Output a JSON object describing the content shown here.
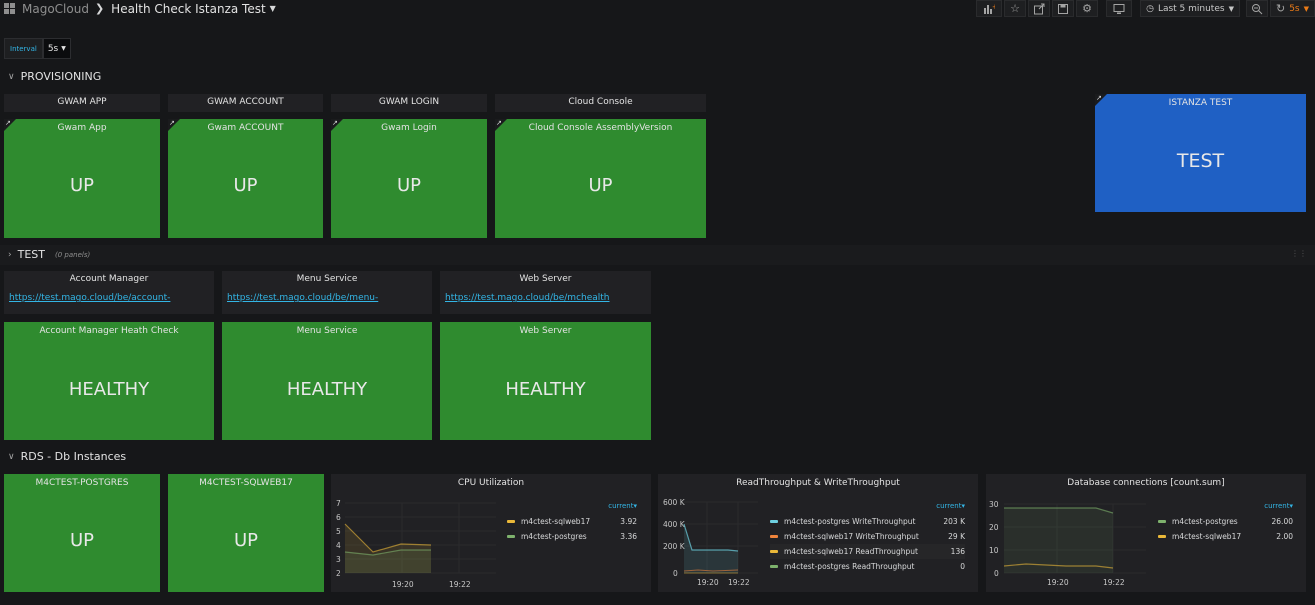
{
  "breadcrumb": {
    "root": "MagoCloud",
    "dashboard": "Health Check Istanza Test"
  },
  "toolbar": {
    "time_range": "Last 5 minutes",
    "refresh": "5s"
  },
  "variable": {
    "label": "Interval",
    "value": "5s"
  },
  "rows": {
    "provisioning": {
      "title": "PROVISIONING"
    },
    "test": {
      "title": "TEST",
      "subtitle": "(0 panels)"
    },
    "rds": {
      "title": "RDS - Db Instances"
    }
  },
  "provisioning": {
    "headers": [
      "GWAM APP",
      "GWAM ACCOUNT",
      "GWAM LOGIN",
      "Cloud Console"
    ],
    "stats": [
      {
        "title": "Gwam App",
        "value": "UP"
      },
      {
        "title": "Gwam ACCOUNT",
        "value": "UP"
      },
      {
        "title": "Gwam Login",
        "value": "UP"
      },
      {
        "title": "Cloud Console AssemblyVersion",
        "value": "UP"
      }
    ],
    "istanza": {
      "title": "ISTANZA TEST",
      "value": "TEST"
    }
  },
  "test": {
    "links": [
      {
        "title": "Account Manager",
        "url": "https://test.mago.cloud/be/account-"
      },
      {
        "title": "Menu Service",
        "url": "https://test.mago.cloud/be/menu-"
      },
      {
        "title": "Web Server",
        "url": "https://test.mago.cloud/be/mchealth"
      }
    ],
    "stats": [
      {
        "title": "Account Manager Heath Check",
        "value": "HEALTHY"
      },
      {
        "title": "Menu Service",
        "value": "HEALTHY"
      },
      {
        "title": "Web Server",
        "value": "HEALTHY"
      }
    ]
  },
  "rds": {
    "stats": [
      {
        "title": "M4CTEST-POSTGRES",
        "value": "UP"
      },
      {
        "title": "M4CTEST-SQLWEB17",
        "value": "UP"
      }
    ],
    "graphs": [
      {
        "title": "CPU Utilization",
        "legend_header": "current",
        "y_ticks": [
          "7",
          "6",
          "5",
          "4",
          "3",
          "2"
        ],
        "x_ticks": [
          "19:20",
          "19:22"
        ],
        "series": [
          {
            "name": "m4ctest-sqlweb17",
            "color": "#eab839",
            "current": "3.92",
            "points": [
              6.5,
              3.1,
              3.9,
              3.92
            ]
          },
          {
            "name": "m4ctest-postgres",
            "color": "#7eb26d",
            "current": "3.36",
            "points": [
              3.0,
              2.8,
              3.3,
              3.36
            ]
          }
        ]
      },
      {
        "title": "ReadThroughput & WriteThroughput",
        "legend_header": "current",
        "y_ticks": [
          "600 K",
          "400 K",
          "200 K",
          "0"
        ],
        "x_ticks": [
          "19:20",
          "19:22"
        ],
        "series": [
          {
            "name": "m4ctest-postgres WriteThroughput",
            "color": "#6ed0e0",
            "current": "203 K"
          },
          {
            "name": "m4ctest-sqlweb17 WriteThroughput",
            "color": "#ef843c",
            "current": "29 K"
          },
          {
            "name": "m4ctest-sqlweb17 ReadThroughput",
            "color": "#eab839",
            "current": "136"
          },
          {
            "name": "m4ctest-postgres ReadThroughput",
            "color": "#7eb26d",
            "current": "0"
          }
        ]
      },
      {
        "title": "Database connections [count.sum]",
        "legend_header": "current",
        "y_ticks": [
          "30",
          "20",
          "10",
          "0"
        ],
        "x_ticks": [
          "19:20",
          "19:22"
        ],
        "series": [
          {
            "name": "m4ctest-postgres",
            "color": "#7eb26d",
            "current": "26.00"
          },
          {
            "name": "m4ctest-sqlweb17",
            "color": "#eab839",
            "current": "2.00"
          }
        ]
      }
    ]
  }
}
